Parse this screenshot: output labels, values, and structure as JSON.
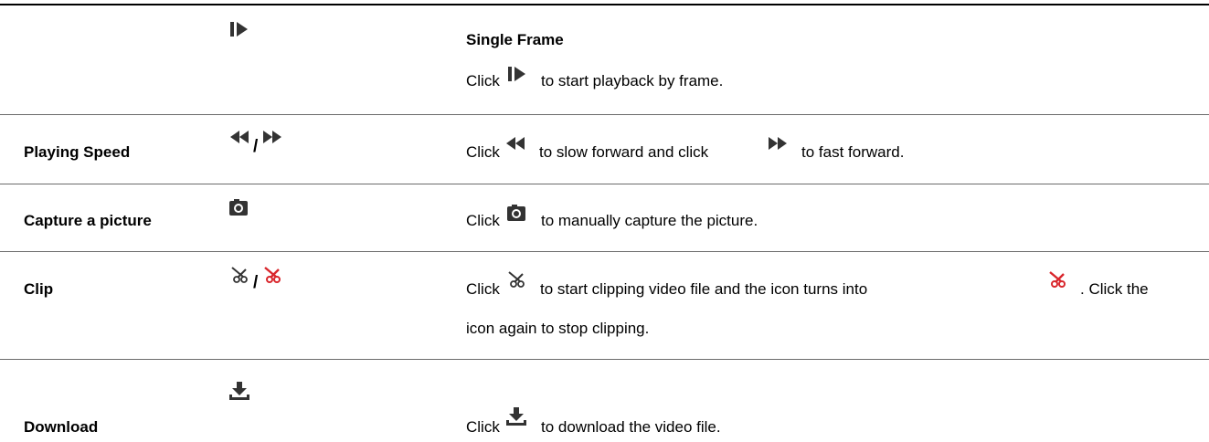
{
  "rows": [
    {
      "feature": "",
      "icons": [
        "single-frame-icon"
      ],
      "title": "Single Frame",
      "desc_prefix": "Click",
      "desc_suffix": "to start playback by frame."
    },
    {
      "feature": "Playing Speed",
      "icons": [
        "slow-forward-icon",
        "fast-forward-icon"
      ],
      "separator": "/",
      "desc_prefix": "Click",
      "desc_middle": "to slow forward and click",
      "desc_suffix": "to fast forward."
    },
    {
      "feature": "Capture a picture",
      "icons": [
        "camera-icon"
      ],
      "desc_prefix": "Click",
      "desc_suffix": "to manually capture the picture."
    },
    {
      "feature": "Clip",
      "icons": [
        "scissors-icon",
        "scissors-active-icon"
      ],
      "separator": "/",
      "desc_prefix": "Click",
      "desc_middle": "to start clipping video file and the icon turns into",
      "desc_suffix": ". Click the",
      "desc_line2": "icon again to stop clipping."
    },
    {
      "feature": "Download",
      "icons": [
        "download-icon"
      ],
      "desc_prefix": "Click",
      "desc_suffix": "to download the video file."
    }
  ],
  "colors": {
    "icon": "#333333",
    "active_icon": "#d9262c",
    "rule": "#000000"
  }
}
